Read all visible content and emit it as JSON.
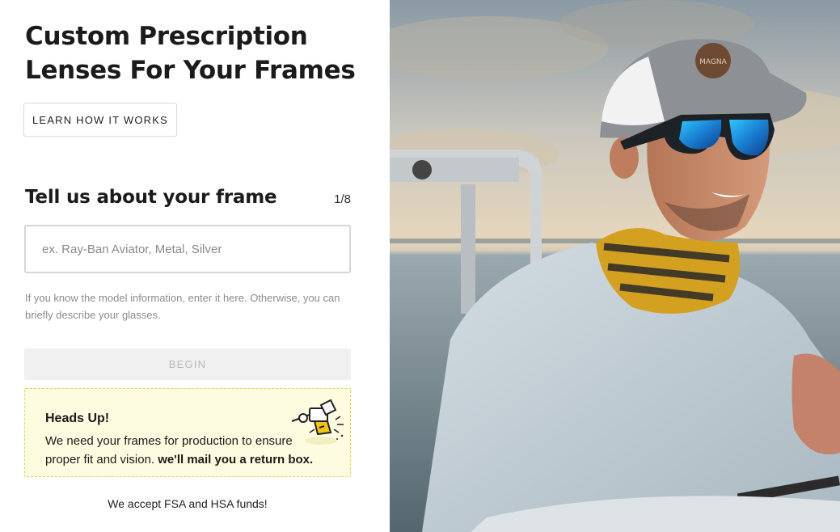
{
  "hero": {
    "title": "Custom Prescription Lenses For Your Frames",
    "learn_button": "LEARN HOW IT WORKS"
  },
  "form": {
    "step_title": "Tell us about your frame",
    "step_count": "1/8",
    "input_placeholder": "ex. Ray-Ban Aviator, Metal, Silver",
    "input_value": "",
    "help_text": "If you know the model information, enter it here. Otherwise, you can briefly describe your glasses.",
    "begin_button": "BEGIN"
  },
  "notice": {
    "title": "Heads Up!",
    "body_plain": "We need your frames for production to ensure proper fit and vision.",
    "body_bold": "we'll mail you a return box.",
    "icon": "mail-delivery-icon"
  },
  "footer": {
    "fsa_text": "We accept FSA and HSA funds!"
  },
  "photo": {
    "cap_patch_text": "MAGNA",
    "theme_colors": {
      "notice_bg": "#fdfbe0",
      "notice_border": "#e6d55a",
      "button_disabled_bg": "#f0f0f0"
    }
  }
}
